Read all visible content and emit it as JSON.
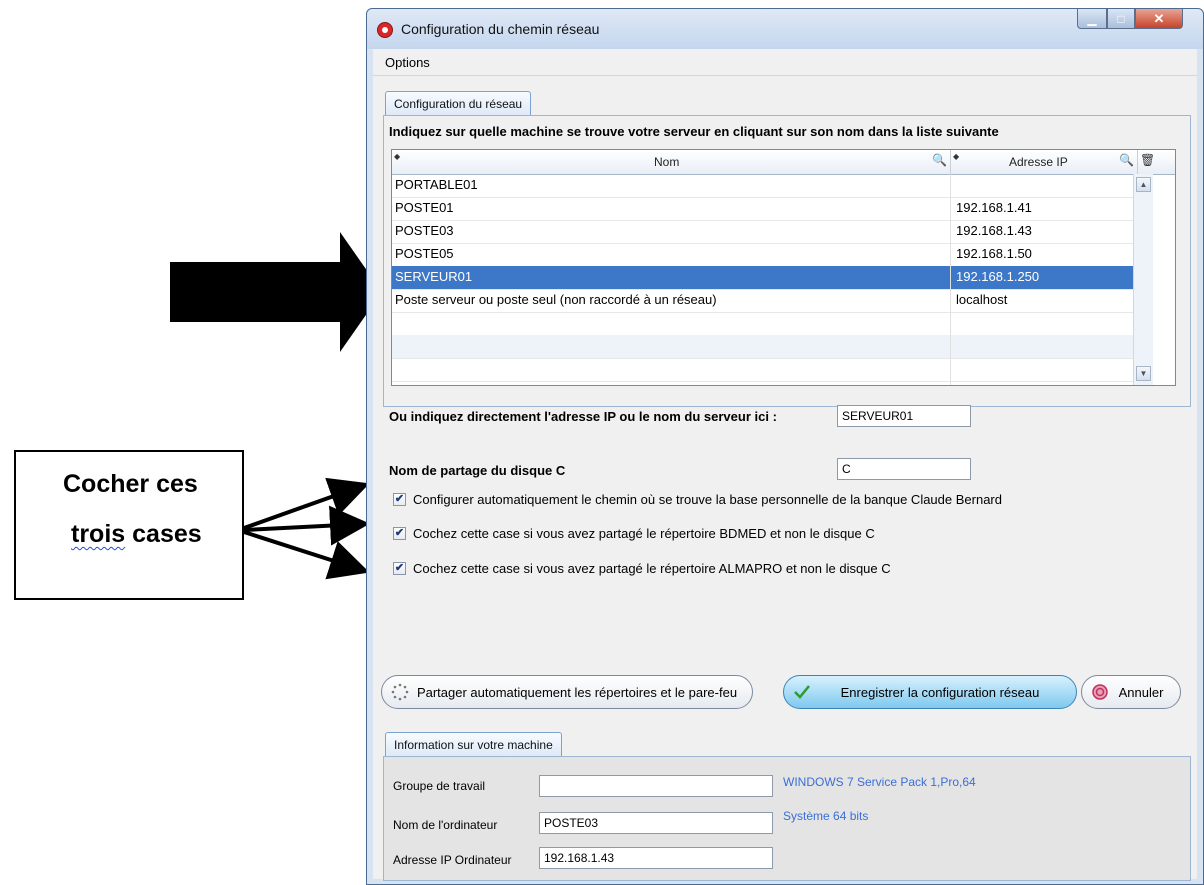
{
  "annotation": {
    "callout_line1": "Cocher ces",
    "callout_line2_word1": "trois",
    "callout_line2_word2": "cases"
  },
  "window": {
    "title": "Configuration du chemin réseau",
    "close_glyph": "✕",
    "minimize_glyph": "▁",
    "maximize_glyph": "□"
  },
  "menu": {
    "options": "Options"
  },
  "network_group": {
    "tab_label": "Configuration du réseau",
    "instruction": "Indiquez sur quelle machine se trouve votre serveur en cliquant sur son nom dans la liste suivante",
    "columns": [
      "Nom",
      "Adresse IP"
    ],
    "rows": [
      {
        "nom": "PORTABLE01",
        "ip": ""
      },
      {
        "nom": "POSTE01",
        "ip": "192.168.1.41"
      },
      {
        "nom": "POSTE03",
        "ip": "192.168.1.43"
      },
      {
        "nom": "POSTE05",
        "ip": "192.168.1.50"
      },
      {
        "nom": "SERVEUR01",
        "ip": "192.168.1.250"
      },
      {
        "nom": "Poste serveur ou poste seul (non raccordé à un réseau)",
        "ip": "localhost"
      }
    ],
    "selected_row": 4,
    "direct_label": "Ou indiquez directement l'adresse IP ou le nom du serveur  ici :",
    "direct_value": "SERVEUR01",
    "share_label": "Nom de partage du disque C",
    "share_value": "C",
    "checkboxes": [
      {
        "label": "Configurer automatiquement le chemin où se trouve la base personnelle de la banque Claude Bernard",
        "checked": true
      },
      {
        "label": "Cochez cette case si vous avez partagé le répertoire BDMED et non le disque C",
        "checked": true
      },
      {
        "label": "Cochez cette case si vous avez partagé le répertoire ALMAPRO et non le disque C",
        "checked": true
      }
    ]
  },
  "buttons": {
    "share": "Partager automatiquement les répertoires et le pare-feu",
    "save": "Enregistrer la configuration réseau",
    "cancel": "Annuler"
  },
  "machine_group": {
    "tab_label": "Information sur votre machine",
    "workgroup_label": "Groupe de travail",
    "workgroup_value": "",
    "computer_label": "Nom de l'ordinateur",
    "computer_value": "POSTE03",
    "ip_label": "Adresse IP Ordinateur",
    "ip_value": "192.168.1.43",
    "os_info": "WINDOWS 7 Service Pack 1,Pro,64",
    "bits_info": "Système 64 bits"
  },
  "colors": {
    "selection": "#3d77c7",
    "info_text": "#3a6fd6",
    "window_frame": "#d6e3f3"
  }
}
